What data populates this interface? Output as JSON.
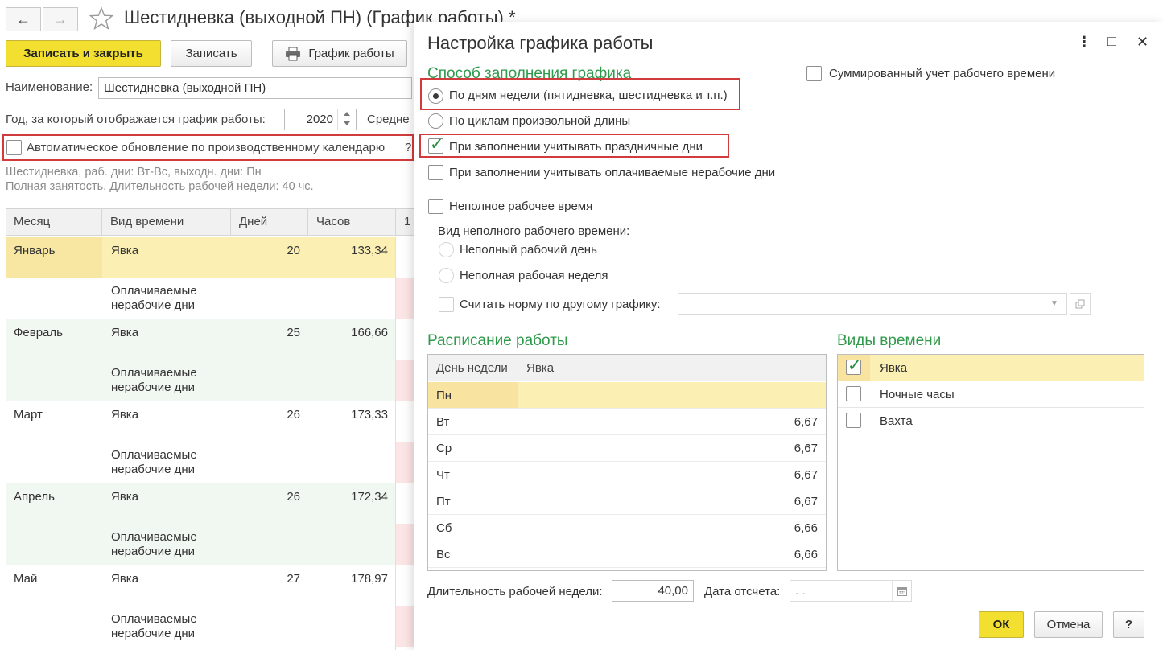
{
  "form": {
    "title": "Шестидневка (выходной ПН) (График работы) *",
    "nav_back": "←",
    "nav_forward": "→",
    "favorite_icon": "star-icon",
    "buttons": {
      "save_close": "Записать и закрыть",
      "save": "Записать",
      "schedule": "График работы"
    },
    "name_label": "Наименование:",
    "name_value": "Шестидневка (выходной ПН)",
    "year_label": "Год, за который отображается график работы:",
    "year_value": "2020",
    "avg_label": "Средне",
    "auto_update_label": "Автоматическое обновление по производственному календарю",
    "auto_update_checked": false,
    "help_mark": "?",
    "info_line1": "Шестидневка, раб. дни: Вт-Вс, выходн. дни: Пн",
    "info_line2": "Полная занятость. Длительность рабочей недели: 40 чс.",
    "grid": {
      "headers": [
        "Месяц",
        "Вид времени",
        "Дней",
        "Часов",
        "1"
      ],
      "rows": [
        {
          "month": "Январь",
          "kind": "Явка",
          "days": "20",
          "hours": "133,34",
          "kind2": "Оплачиваемые нерабочие дни"
        },
        {
          "month": "Февраль",
          "kind": "Явка",
          "days": "25",
          "hours": "166,66",
          "kind2": "Оплачиваемые нерабочие дни"
        },
        {
          "month": "Март",
          "kind": "Явка",
          "days": "26",
          "hours": "173,33",
          "kind2": "Оплачиваемые нерабочие дни"
        },
        {
          "month": "Апрель",
          "kind": "Явка",
          "days": "26",
          "hours": "172,34",
          "kind2": "Оплачиваемые нерабочие дни"
        },
        {
          "month": "Май",
          "kind": "Явка",
          "days": "27",
          "hours": "178,97",
          "kind2": "Оплачиваемые нерабочие дни"
        }
      ]
    }
  },
  "dialog": {
    "title": "Настройка графика работы",
    "icons": {
      "more": "⋮",
      "maximize": "□",
      "close": "✕"
    },
    "fill_method_title": "Способ заполнения графика",
    "summarized_label": "Суммированный учет рабочего времени",
    "summarized_checked": false,
    "opt_by_weekdays": "По дням недели (пятидневка, шестидневка и т.п.)",
    "opt_by_cycles": "По циклам произвольной длины",
    "selected_method": "by_weekdays",
    "holidays_label": "При заполнении учитывать праздничные дни",
    "holidays_checked": true,
    "paid_nonwork_label": "При заполнении учитывать оплачиваемые нерабочие дни",
    "paid_nonwork_checked": false,
    "part_time_label": "Неполное рабочее время",
    "part_time_checked": false,
    "part_time_kind_label": "Вид неполного рабочего времени:",
    "part_day_label": "Неполный рабочий день",
    "part_week_label": "Неполная рабочая неделя",
    "other_norm_label": "Считать норму по другому графику:",
    "other_norm_value": "",
    "schedule_title": "Расписание работы",
    "schedule": {
      "headers": [
        "День недели",
        "Явка"
      ],
      "rows": [
        {
          "day": "Пн",
          "value": ""
        },
        {
          "day": "Вт",
          "value": "6,67"
        },
        {
          "day": "Ср",
          "value": "6,67"
        },
        {
          "day": "Чт",
          "value": "6,67"
        },
        {
          "day": "Пт",
          "value": "6,67"
        },
        {
          "day": "Сб",
          "value": "6,66"
        },
        {
          "day": "Вс",
          "value": "6,66"
        }
      ]
    },
    "time_kinds_title": "Виды времени",
    "time_kinds": [
      {
        "label": "Явка",
        "checked": true
      },
      {
        "label": "Ночные часы",
        "checked": false
      },
      {
        "label": "Вахта",
        "checked": false
      }
    ],
    "week_length_label": "Длительность рабочей недели:",
    "week_length_value": "40,00",
    "ref_date_label": "Дата отсчета:",
    "ref_date_value": " .  .",
    "ok_label": "ОК",
    "cancel_label": "Отмена",
    "help_label": "?"
  },
  "colors": {
    "accent_yellow": "#f3df2f",
    "selected_row": "#fcefb4",
    "group_tint": "#f1f7f1",
    "green_title": "#2f9a4b",
    "highlight_red": "#d23b3b"
  }
}
